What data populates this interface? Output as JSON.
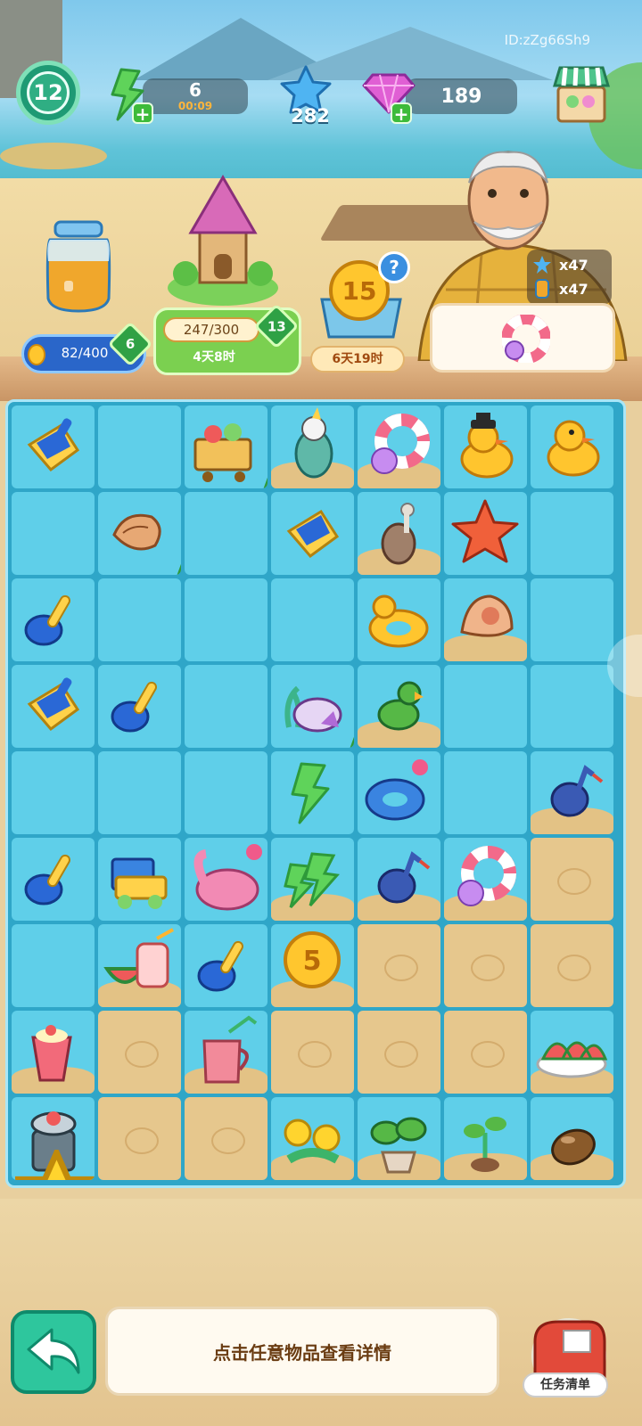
{
  "hud": {
    "id_text": "ID:zZg66Sh9",
    "level": "12",
    "energy_value": "6",
    "energy_timer": "00:09",
    "stars": "282",
    "gems": "189"
  },
  "progress": {
    "jar_text": "82/400",
    "jar_level": "6",
    "jar_fraction": 0.205,
    "house_text": "247/300",
    "house_level": "13",
    "house_timer": "4天8时",
    "house_fraction": 0.823,
    "coin_value": "15",
    "coin_timer": "6天19时",
    "help_symbol": "?"
  },
  "reward": {
    "star_count": "x47",
    "drink_count": "x47"
  },
  "board": {
    "item_names": [
      "shovel-scoop-icon",
      "picnic-cart-icon",
      "cockatoo-icon",
      "swim-ring-icon",
      "duck-hat-icon",
      "rubber-duck-icon",
      "conch-shell-icon",
      "sand-shovel-icon",
      "seabird-icon",
      "starfish-icon",
      "shovel-icon",
      "duck-floatie-icon",
      "shell-icon",
      "coral-shell-icon",
      "parrot-icon",
      "energy-bolt-icon",
      "shark-float-icon",
      "blue-bird-icon",
      "toy-truck-icon",
      "flamingo-float-icon",
      "double-bolt-icon",
      "watermelon-juice-icon",
      "gold-coin-icon",
      "smoothie-icon",
      "juice-pitcher-icon",
      "watermelon-plate-icon",
      "juicer-icon",
      "yellow-flowers-icon",
      "potted-plant-icon",
      "sprout-icon",
      "seed-icon"
    ],
    "coin_tile_value": "5"
  },
  "bottom": {
    "hint": "点击任意物品查看详情",
    "task_list": "任务清单"
  },
  "colors": {
    "board": "#2fa6c8",
    "cell": "#5fcfe9",
    "sand": "#e6c78d",
    "accent_green": "#2ec69d"
  }
}
